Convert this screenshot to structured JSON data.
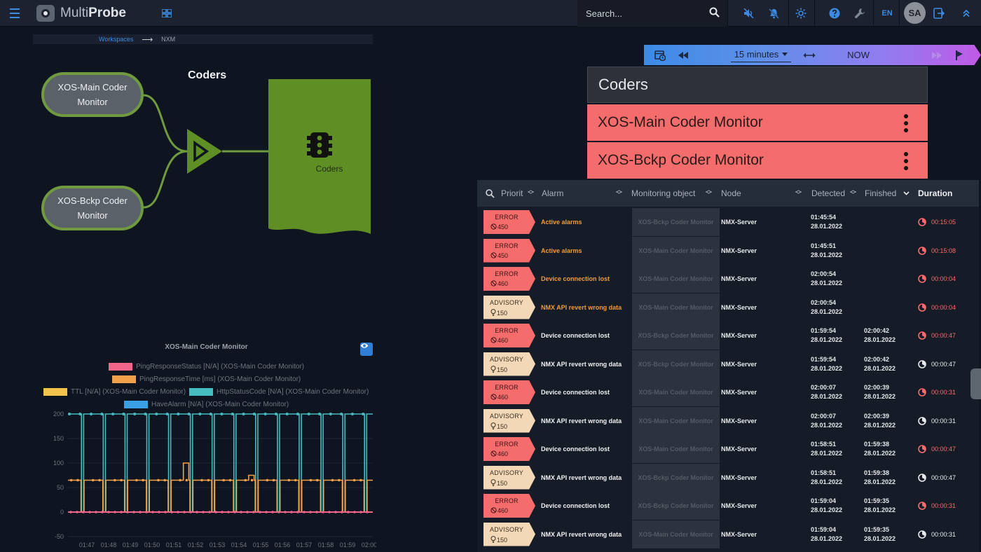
{
  "app": {
    "brand_light": "Multi",
    "brand_bold": "Probe"
  },
  "topbar": {
    "search_placeholder": "Search...",
    "language": "EN",
    "user_initials": "SA"
  },
  "breadcrumb": {
    "parent": "Workspaces",
    "current": "NXM"
  },
  "diagram": {
    "title": "Coders",
    "source_nodes": [
      {
        "line1": "XOS-Main Coder",
        "line2": "Monitor"
      },
      {
        "line1": "XOS-Bckp Coder",
        "line2": "Monitor"
      }
    ],
    "target_label": "Coders",
    "node_border_color": "#6f9a3f",
    "target_color": "#5f8f24"
  },
  "chart": {
    "title": "XOS-Main Coder Monitor",
    "legend": [
      {
        "label": "PingResponseStatus [N/A] (XOS-Main Coder Monitor)",
        "color": "#f0668a"
      },
      {
        "label": "PingResponseTime [ms] (XOS-Main Coder Monitor)",
        "color": "#f2a04a"
      },
      {
        "label": "TTL [N/A] (XOS-Main Coder Monitor)",
        "color": "#f4c24a"
      },
      {
        "label": "HttpStatusCode [N/A] (XOS-Main Coder Monitor)",
        "color": "#45bcc0"
      },
      {
        "label": "HaveAlarm [N/A] (XOS-Main Coder Monitor)",
        "color": "#3aa0e6"
      }
    ]
  },
  "chart_data": {
    "type": "line",
    "title": "XOS-Main Coder Monitor",
    "x": [
      "01:47",
      "01:48",
      "01:49",
      "01:50",
      "01:51",
      "01:52",
      "01:53",
      "01:54",
      "01:55",
      "01:56",
      "01:57",
      "01:58",
      "01:59",
      "02:00"
    ],
    "yticks": [
      200,
      150,
      100,
      50,
      0,
      -50
    ],
    "ylim": [
      -50,
      200
    ],
    "series": [
      {
        "name": "PingResponseStatus [N/A] (XOS-Main Coder Monitor)",
        "color": "#f0668a",
        "pattern": "flat",
        "values": [
          0
        ]
      },
      {
        "name": "PingResponseTime [ms] (XOS-Main Coder Monitor)",
        "color": "#f2a04a",
        "pattern": "pulse",
        "high": 65,
        "low": 0,
        "spikes": [
          {
            "at": 5,
            "value": 100
          },
          {
            "at": 8,
            "value": 75
          }
        ]
      },
      {
        "name": "HttpStatusCode [N/A] (XOS-Main Coder Monitor)",
        "color": "#45bcc0",
        "pattern": "pulse",
        "high": 200,
        "low": 0
      }
    ],
    "grid": true,
    "legend_position": "top"
  },
  "timebar": {
    "range": "15 minutes",
    "now": "NOW"
  },
  "coders_panel": {
    "title": "Coders",
    "items": [
      {
        "name": "XOS-Main Coder Monitor"
      },
      {
        "name": "XOS-Bckp Coder Monitor"
      }
    ],
    "alarm_color": "#f46c6c"
  },
  "alarms": {
    "columns": {
      "priority": "Priorit",
      "alarm": "Alarm",
      "monitoring_object": "Monitoring object",
      "node": "Node",
      "detected": "Detected",
      "finished": "Finished",
      "duration": "Duration"
    },
    "rows": [
      {
        "severity": "ERROR",
        "code": "450",
        "alarm": "Active alarms",
        "object": "XOS-Bckp Coder Monitor",
        "node": "NMX-Server",
        "detected_time": "01:45:54",
        "detected_date": "28.01.2022",
        "finished_time": "",
        "finished_date": "",
        "duration": "00:15:05",
        "active": true
      },
      {
        "severity": "ERROR",
        "code": "450",
        "alarm": "Active alarms",
        "object": "XOS-Main Coder Monitor",
        "node": "NMX-Server",
        "detected_time": "01:45:51",
        "detected_date": "28.01.2022",
        "finished_time": "",
        "finished_date": "",
        "duration": "00:15:08",
        "active": true
      },
      {
        "severity": "ERROR",
        "code": "460",
        "alarm": "Device connection lost",
        "object": "XOS-Main Coder Monitor",
        "node": "NMX-Server",
        "detected_time": "02:00:54",
        "detected_date": "28.01.2022",
        "finished_time": "",
        "finished_date": "",
        "duration": "00:00:04",
        "active": true
      },
      {
        "severity": "ADVISORY",
        "code": "150",
        "alarm": "NMX API revert wrong data",
        "object": "XOS-Main Coder Monitor",
        "node": "NMX-Server",
        "detected_time": "02:00:54",
        "detected_date": "28.01.2022",
        "finished_time": "",
        "finished_date": "",
        "duration": "00:00:04",
        "active": true
      },
      {
        "severity": "ERROR",
        "code": "460",
        "alarm": "Device connection lost",
        "object": "XOS-Bckp Coder Monitor",
        "node": "NMX-Server",
        "detected_time": "01:59:54",
        "detected_date": "28.01.2022",
        "finished_time": "02:00:42",
        "finished_date": "28.01.2022",
        "duration": "00:00:47",
        "active": false
      },
      {
        "severity": "ADVISORY",
        "code": "150",
        "alarm": "NMX API revert wrong data",
        "object": "XOS-Bckp Coder Monitor",
        "node": "NMX-Server",
        "detected_time": "01:59:54",
        "detected_date": "28.01.2022",
        "finished_time": "02:00:42",
        "finished_date": "28.01.2022",
        "duration": "00:00:47",
        "active": false
      },
      {
        "severity": "ERROR",
        "code": "460",
        "alarm": "Device connection lost",
        "object": "XOS-Main Coder Monitor",
        "node": "NMX-Server",
        "detected_time": "02:00:07",
        "detected_date": "28.01.2022",
        "finished_time": "02:00:39",
        "finished_date": "28.01.2022",
        "duration": "00:00:31",
        "active": false
      },
      {
        "severity": "ADVISORY",
        "code": "150",
        "alarm": "NMX API revert wrong data",
        "object": "XOS-Main Coder Monitor",
        "node": "NMX-Server",
        "detected_time": "02:00:07",
        "detected_date": "28.01.2022",
        "finished_time": "02:00:39",
        "finished_date": "28.01.2022",
        "duration": "00:00:31",
        "active": false
      },
      {
        "severity": "ERROR",
        "code": "460",
        "alarm": "Device connection lost",
        "object": "XOS-Main Coder Monitor",
        "node": "NMX-Server",
        "detected_time": "01:58:51",
        "detected_date": "28.01.2022",
        "finished_time": "01:59:38",
        "finished_date": "28.01.2022",
        "duration": "00:00:47",
        "active": false
      },
      {
        "severity": "ADVISORY",
        "code": "150",
        "alarm": "NMX API revert wrong data",
        "object": "XOS-Bckp Coder Monitor",
        "node": "NMX-Server",
        "detected_time": "01:58:51",
        "detected_date": "28.01.2022",
        "finished_time": "01:59:38",
        "finished_date": "28.01.2022",
        "duration": "00:00:47",
        "active": false
      },
      {
        "severity": "ERROR",
        "code": "460",
        "alarm": "Device connection lost",
        "object": "XOS-Bckp Coder Monitor",
        "node": "NMX-Server",
        "detected_time": "01:59:04",
        "detected_date": "28.01.2022",
        "finished_time": "01:59:35",
        "finished_date": "28.01.2022",
        "duration": "00:00:31",
        "active": false
      },
      {
        "severity": "ADVISORY",
        "code": "150",
        "alarm": "NMX API revert wrong data",
        "object": "XOS-Main Coder Monitor",
        "node": "NMX-Server",
        "detected_time": "01:59:04",
        "detected_date": "28.01.2022",
        "finished_time": "01:59:35",
        "finished_date": "28.01.2022",
        "duration": "00:00:31",
        "active": false
      }
    ]
  }
}
